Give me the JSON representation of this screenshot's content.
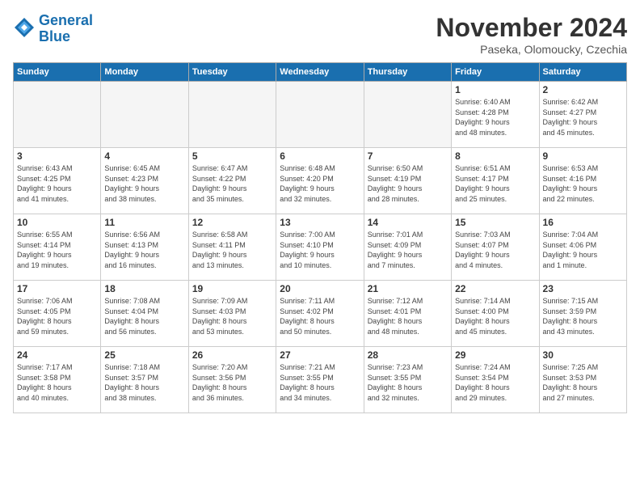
{
  "logo": {
    "line1": "General",
    "line2": "Blue"
  },
  "header": {
    "month": "November 2024",
    "location": "Paseka, Olomoucky, Czechia"
  },
  "weekdays": [
    "Sunday",
    "Monday",
    "Tuesday",
    "Wednesday",
    "Thursday",
    "Friday",
    "Saturday"
  ],
  "weeks": [
    [
      {
        "day": "",
        "info": ""
      },
      {
        "day": "",
        "info": ""
      },
      {
        "day": "",
        "info": ""
      },
      {
        "day": "",
        "info": ""
      },
      {
        "day": "",
        "info": ""
      },
      {
        "day": "1",
        "info": "Sunrise: 6:40 AM\nSunset: 4:28 PM\nDaylight: 9 hours\nand 48 minutes."
      },
      {
        "day": "2",
        "info": "Sunrise: 6:42 AM\nSunset: 4:27 PM\nDaylight: 9 hours\nand 45 minutes."
      }
    ],
    [
      {
        "day": "3",
        "info": "Sunrise: 6:43 AM\nSunset: 4:25 PM\nDaylight: 9 hours\nand 41 minutes."
      },
      {
        "day": "4",
        "info": "Sunrise: 6:45 AM\nSunset: 4:23 PM\nDaylight: 9 hours\nand 38 minutes."
      },
      {
        "day": "5",
        "info": "Sunrise: 6:47 AM\nSunset: 4:22 PM\nDaylight: 9 hours\nand 35 minutes."
      },
      {
        "day": "6",
        "info": "Sunrise: 6:48 AM\nSunset: 4:20 PM\nDaylight: 9 hours\nand 32 minutes."
      },
      {
        "day": "7",
        "info": "Sunrise: 6:50 AM\nSunset: 4:19 PM\nDaylight: 9 hours\nand 28 minutes."
      },
      {
        "day": "8",
        "info": "Sunrise: 6:51 AM\nSunset: 4:17 PM\nDaylight: 9 hours\nand 25 minutes."
      },
      {
        "day": "9",
        "info": "Sunrise: 6:53 AM\nSunset: 4:16 PM\nDaylight: 9 hours\nand 22 minutes."
      }
    ],
    [
      {
        "day": "10",
        "info": "Sunrise: 6:55 AM\nSunset: 4:14 PM\nDaylight: 9 hours\nand 19 minutes."
      },
      {
        "day": "11",
        "info": "Sunrise: 6:56 AM\nSunset: 4:13 PM\nDaylight: 9 hours\nand 16 minutes."
      },
      {
        "day": "12",
        "info": "Sunrise: 6:58 AM\nSunset: 4:11 PM\nDaylight: 9 hours\nand 13 minutes."
      },
      {
        "day": "13",
        "info": "Sunrise: 7:00 AM\nSunset: 4:10 PM\nDaylight: 9 hours\nand 10 minutes."
      },
      {
        "day": "14",
        "info": "Sunrise: 7:01 AM\nSunset: 4:09 PM\nDaylight: 9 hours\nand 7 minutes."
      },
      {
        "day": "15",
        "info": "Sunrise: 7:03 AM\nSunset: 4:07 PM\nDaylight: 9 hours\nand 4 minutes."
      },
      {
        "day": "16",
        "info": "Sunrise: 7:04 AM\nSunset: 4:06 PM\nDaylight: 9 hours\nand 1 minute."
      }
    ],
    [
      {
        "day": "17",
        "info": "Sunrise: 7:06 AM\nSunset: 4:05 PM\nDaylight: 8 hours\nand 59 minutes."
      },
      {
        "day": "18",
        "info": "Sunrise: 7:08 AM\nSunset: 4:04 PM\nDaylight: 8 hours\nand 56 minutes."
      },
      {
        "day": "19",
        "info": "Sunrise: 7:09 AM\nSunset: 4:03 PM\nDaylight: 8 hours\nand 53 minutes."
      },
      {
        "day": "20",
        "info": "Sunrise: 7:11 AM\nSunset: 4:02 PM\nDaylight: 8 hours\nand 50 minutes."
      },
      {
        "day": "21",
        "info": "Sunrise: 7:12 AM\nSunset: 4:01 PM\nDaylight: 8 hours\nand 48 minutes."
      },
      {
        "day": "22",
        "info": "Sunrise: 7:14 AM\nSunset: 4:00 PM\nDaylight: 8 hours\nand 45 minutes."
      },
      {
        "day": "23",
        "info": "Sunrise: 7:15 AM\nSunset: 3:59 PM\nDaylight: 8 hours\nand 43 minutes."
      }
    ],
    [
      {
        "day": "24",
        "info": "Sunrise: 7:17 AM\nSunset: 3:58 PM\nDaylight: 8 hours\nand 40 minutes."
      },
      {
        "day": "25",
        "info": "Sunrise: 7:18 AM\nSunset: 3:57 PM\nDaylight: 8 hours\nand 38 minutes."
      },
      {
        "day": "26",
        "info": "Sunrise: 7:20 AM\nSunset: 3:56 PM\nDaylight: 8 hours\nand 36 minutes."
      },
      {
        "day": "27",
        "info": "Sunrise: 7:21 AM\nSunset: 3:55 PM\nDaylight: 8 hours\nand 34 minutes."
      },
      {
        "day": "28",
        "info": "Sunrise: 7:23 AM\nSunset: 3:55 PM\nDaylight: 8 hours\nand 32 minutes."
      },
      {
        "day": "29",
        "info": "Sunrise: 7:24 AM\nSunset: 3:54 PM\nDaylight: 8 hours\nand 29 minutes."
      },
      {
        "day": "30",
        "info": "Sunrise: 7:25 AM\nSunset: 3:53 PM\nDaylight: 8 hours\nand 27 minutes."
      }
    ]
  ]
}
